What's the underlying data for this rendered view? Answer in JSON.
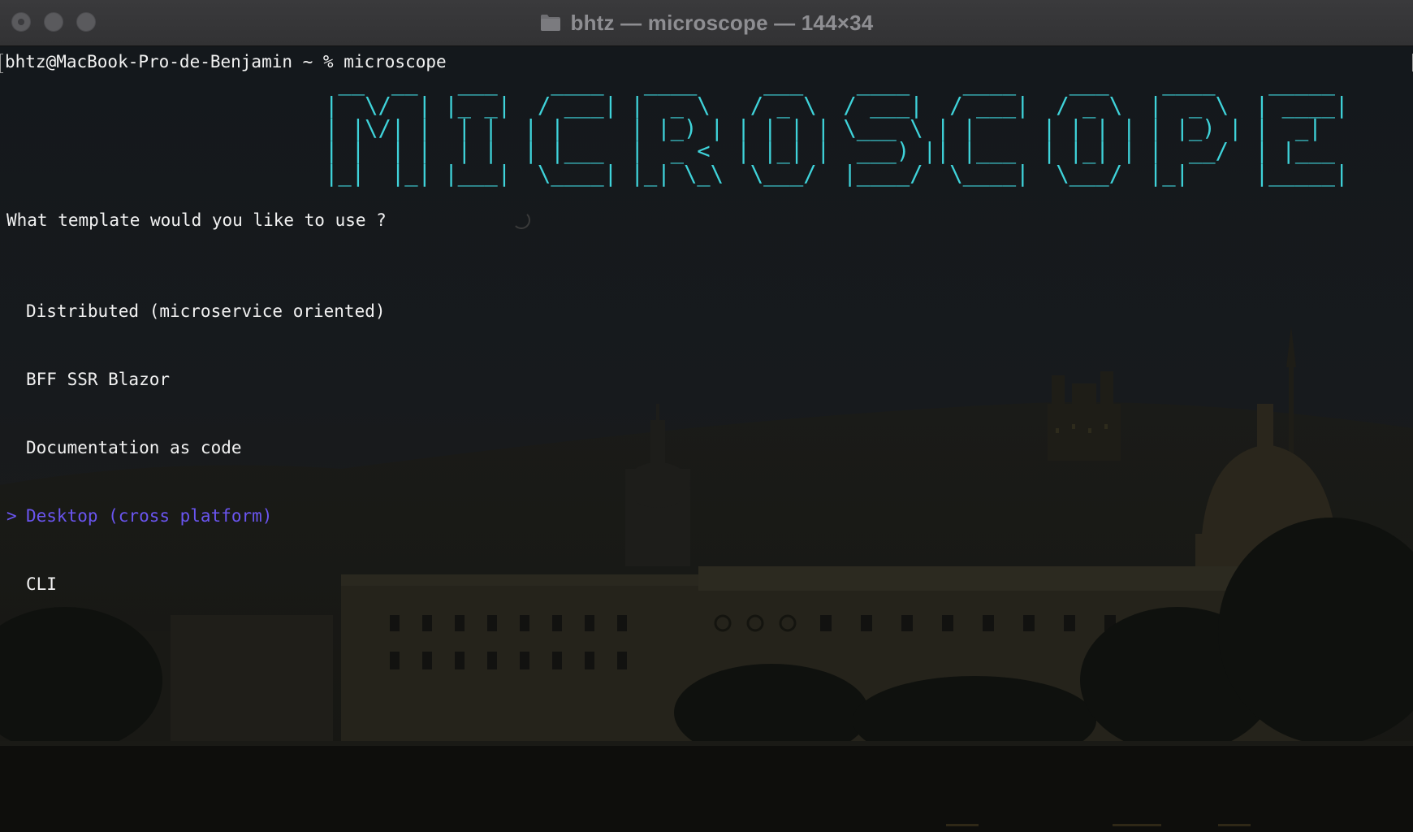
{
  "window": {
    "title": "bhtz — microscope — 144×34"
  },
  "terminal": {
    "prompt": "bhtz@MacBook-Pro-de-Benjamin ~ % microscope",
    "banner": " __  __   ___    ____   ____     ___    ____    ____    ___    ____    _____\n|  \\/  | |_ _|  / ___| |  _ \\   / _ \\  / ___|  / ___|  / _ \\  |  _ \\  | ____|\n| |\\/| |  | |  | |     | |_) | | | | | \\___ \\ | |     | | | | | |_) | |  _|\n| |  | |  | |  | |___  |  _ <  | |_| |  ___) || |___  | |_| | |  __/  | |___\n|_|  |_| |___|  \\____| |_| \\_\\  \\___/  |____/  \\____|  \\___/  |_|     |_____|",
    "question": "What template would you like to use ?",
    "selection_marker": ">",
    "options": [
      {
        "label": "Distributed (microservice oriented)",
        "selected": false
      },
      {
        "label": "BFF SSR Blazor",
        "selected": false
      },
      {
        "label": "Documentation as code",
        "selected": false
      },
      {
        "label": "Desktop (cross platform)",
        "selected": true
      },
      {
        "label": "CLI",
        "selected": false
      }
    ]
  },
  "colors": {
    "banner": "#3fd3da",
    "selected_option": "#6a55f0",
    "text": "#f2f2f2",
    "titlebar": "#38383a"
  },
  "icons": {
    "title": "folder-icon",
    "window_controls": [
      "close-button",
      "minimize-button",
      "zoom-button"
    ]
  }
}
